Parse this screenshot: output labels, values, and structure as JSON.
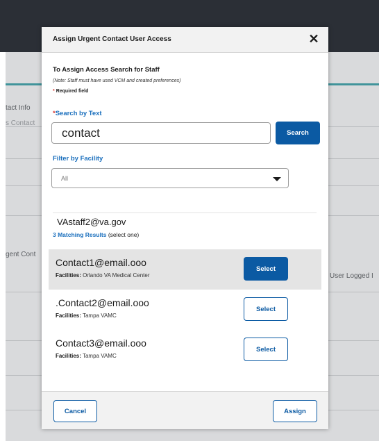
{
  "background": {
    "contact_info_label": "tact Info",
    "contact_tab_label": "s Contact",
    "urgent_contact_label": "gent Cont",
    "user_logged_label": "User Logged I"
  },
  "modal": {
    "title": "Assign Urgent Contact User Access",
    "close_symbol": "✕",
    "heading": "To Assign Access Search for Staff",
    "note": "(Note: Staff must have used VCM and created preferences)",
    "required_note": "Required field",
    "search_label": "Search by Text",
    "search_value": "contact",
    "search_button": "Search",
    "filter_label": "Filter by Facility",
    "filter_selected": "All",
    "searched_email": "VAstaff2@va.gov",
    "match_count": "3 Matching Results",
    "match_hint": "(select one)",
    "facilities_prefix": "Facilities:",
    "results": [
      {
        "email": "Contact1@email.ooo",
        "facility": "Orlando VA Medical Center",
        "button": "Select",
        "selected": true
      },
      {
        "email": ".Contact2@email.ooo",
        "facility": "Tampa VAMC",
        "button": "Select",
        "selected": false
      },
      {
        "email": "Contact3@email.ooo",
        "facility": "Tampa VAMC",
        "button": "Select",
        "selected": false
      }
    ],
    "cancel_button": "Cancel",
    "assign_button": "Assign"
  },
  "colors": {
    "primary": "#0b5aa3",
    "label_blue": "#1a6fbd",
    "required": "#d83933",
    "overlay_dark": "#2b2f36"
  }
}
